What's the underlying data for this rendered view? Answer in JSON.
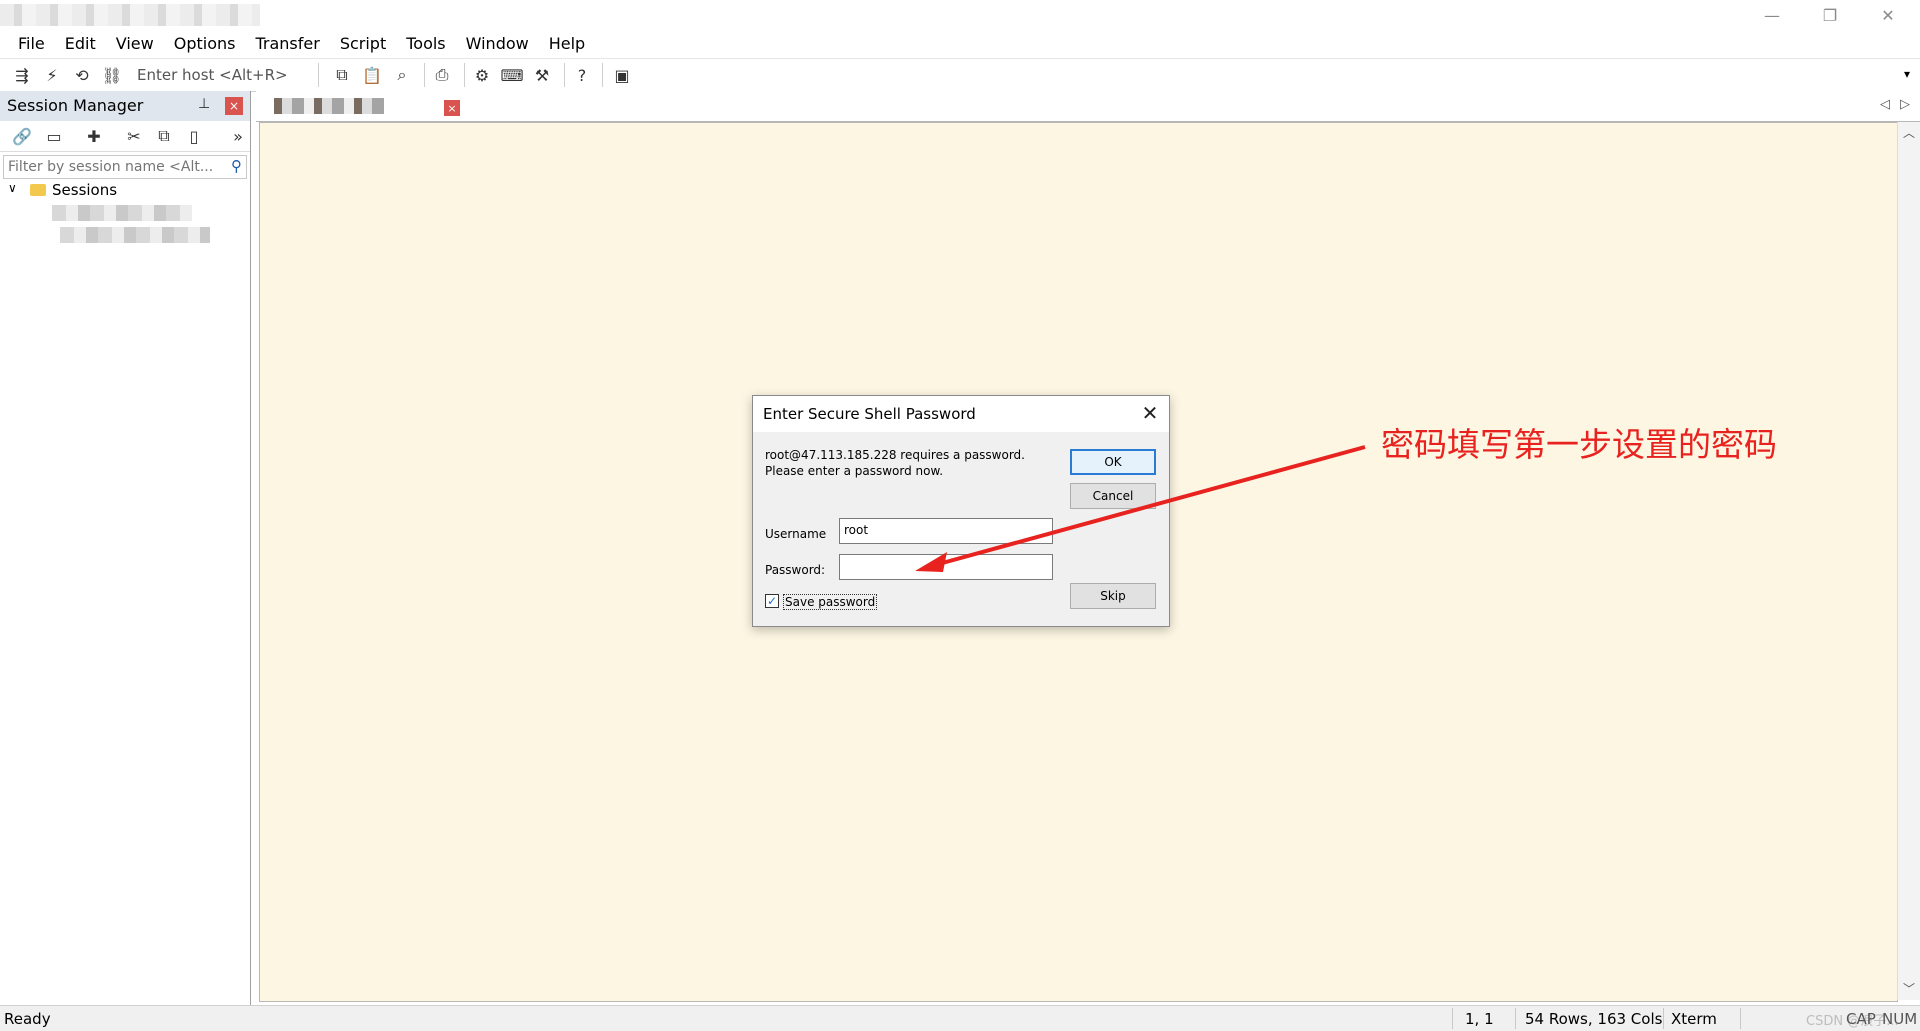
{
  "window": {
    "minimize_glyph": "—",
    "restore_glyph": "❐",
    "close_glyph": "✕"
  },
  "menu": [
    "File",
    "Edit",
    "View",
    "Options",
    "Transfer",
    "Script",
    "Tools",
    "Window",
    "Help"
  ],
  "toolbar": {
    "enter_host_placeholder": "Enter host <Alt+R>",
    "dropdown_glyph": "▾",
    "icons": [
      "connect-icon",
      "quick-connect-icon",
      "reconnect-icon",
      "disconnect-icon",
      "copy-icon",
      "paste-icon",
      "find-icon",
      "print-icon",
      "settings-icon",
      "keymap-icon",
      "sftp-icon",
      "help-icon",
      "screen-icon"
    ]
  },
  "session_manager": {
    "title": "Session Manager",
    "pin_glyph": "📌",
    "close_glyph": "×",
    "filter_placeholder": "Filter by session name <Alt...",
    "more_glyph": "»",
    "tree": {
      "root_label": "Sessions",
      "expand_glyph": "∨"
    }
  },
  "tab": {
    "close_glyph": "×",
    "prev_glyph": "◁",
    "next_glyph": "▷"
  },
  "dialog": {
    "title": "Enter Secure Shell Password",
    "close_glyph": "✕",
    "message_line1": "root@47.113.185.228 requires a password.",
    "message_line2": "Please enter a password now.",
    "username_label": "Username",
    "username_value": "root",
    "password_label": "Password:",
    "password_value": "",
    "save_password_label": "Save password",
    "save_password_checked": true,
    "check_glyph": "✓",
    "ok_label": "OK",
    "cancel_label": "Cancel",
    "skip_label": "Skip"
  },
  "annotation": {
    "text": "密码填写第一步设置的密码",
    "color": "#e8231f"
  },
  "status": {
    "ready": "Ready",
    "position": "1,   1",
    "size": "54 Rows, 163 Cols",
    "terminal_type": "Xterm",
    "caps": "CAP",
    "num": "NUM",
    "watermark": "CSDN @浪子..."
  },
  "colors": {
    "terminal_bg": "#fdf6e3",
    "panel_header": "#dfe6ee",
    "accent": "#2a7bd4",
    "close_red": "#d9534f"
  }
}
